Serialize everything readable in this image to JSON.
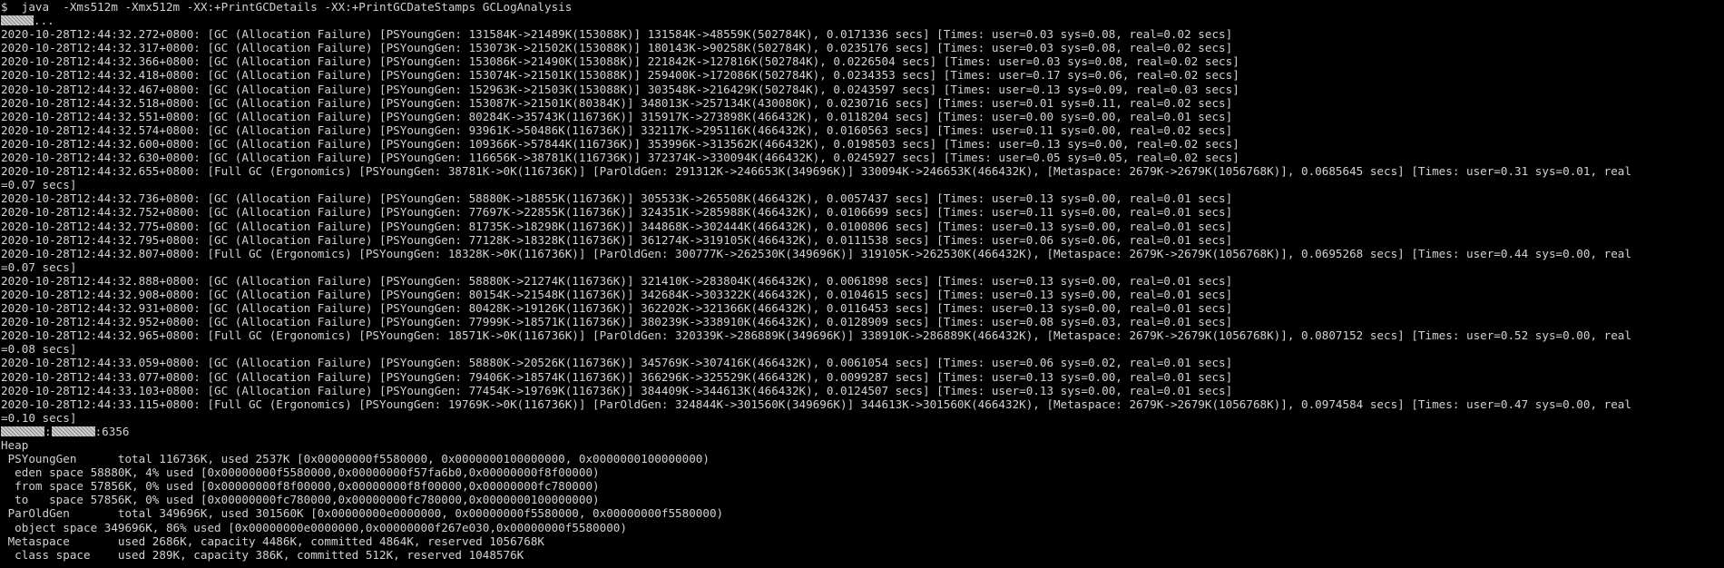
{
  "terminal": {
    "command": "$  java  -Xms512m -Xmx512m -XX:+PrintGCDetails -XX:+PrintGCDateStamps GCLogAnalysis",
    "ellipsis": "...",
    "colon": ":",
    "pid_suffix": ":6356",
    "gc_lines": [
      "2020-10-28T12:44:32.272+0800: [GC (Allocation Failure) [PSYoungGen: 131584K->21489K(153088K)] 131584K->48559K(502784K), 0.0171336 secs] [Times: user=0.03 sys=0.08, real=0.02 secs]",
      "2020-10-28T12:44:32.317+0800: [GC (Allocation Failure) [PSYoungGen: 153073K->21502K(153088K)] 180143K->90258K(502784K), 0.0235176 secs] [Times: user=0.03 sys=0.08, real=0.02 secs]",
      "2020-10-28T12:44:32.366+0800: [GC (Allocation Failure) [PSYoungGen: 153086K->21490K(153088K)] 221842K->127816K(502784K), 0.0226504 secs] [Times: user=0.03 sys=0.08, real=0.02 secs]",
      "2020-10-28T12:44:32.418+0800: [GC (Allocation Failure) [PSYoungGen: 153074K->21501K(153088K)] 259400K->172086K(502784K), 0.0234353 secs] [Times: user=0.17 sys=0.06, real=0.02 secs]",
      "2020-10-28T12:44:32.467+0800: [GC (Allocation Failure) [PSYoungGen: 152963K->21503K(153088K)] 303548K->216429K(502784K), 0.0243597 secs] [Times: user=0.13 sys=0.09, real=0.03 secs]",
      "2020-10-28T12:44:32.518+0800: [GC (Allocation Failure) [PSYoungGen: 153087K->21501K(80384K)] 348013K->257134K(430080K), 0.0230716 secs] [Times: user=0.01 sys=0.11, real=0.02 secs]",
      "2020-10-28T12:44:32.551+0800: [GC (Allocation Failure) [PSYoungGen: 80284K->35743K(116736K)] 315917K->273898K(466432K), 0.0118204 secs] [Times: user=0.00 sys=0.00, real=0.01 secs]",
      "2020-10-28T12:44:32.574+0800: [GC (Allocation Failure) [PSYoungGen: 93961K->50486K(116736K)] 332117K->295116K(466432K), 0.0160563 secs] [Times: user=0.11 sys=0.00, real=0.02 secs]",
      "2020-10-28T12:44:32.600+0800: [GC (Allocation Failure) [PSYoungGen: 109366K->57844K(116736K)] 353996K->313562K(466432K), 0.0198503 secs] [Times: user=0.13 sys=0.00, real=0.02 secs]",
      "2020-10-28T12:44:32.630+0800: [GC (Allocation Failure) [PSYoungGen: 116656K->38781K(116736K)] 372374K->330094K(466432K), 0.0245927 secs] [Times: user=0.05 sys=0.05, real=0.02 secs]",
      "2020-10-28T12:44:32.655+0800: [Full GC (Ergonomics) [PSYoungGen: 38781K->0K(116736K)] [ParOldGen: 291312K->246653K(349696K)] 330094K->246653K(466432K), [Metaspace: 2679K->2679K(1056768K)], 0.0685645 secs] [Times: user=0.31 sys=0.01, real",
      "=0.07 secs]",
      "2020-10-28T12:44:32.736+0800: [GC (Allocation Failure) [PSYoungGen: 58880K->18855K(116736K)] 305533K->265508K(466432K), 0.0057437 secs] [Times: user=0.13 sys=0.00, real=0.01 secs]",
      "2020-10-28T12:44:32.752+0800: [GC (Allocation Failure) [PSYoungGen: 77697K->22855K(116736K)] 324351K->285988K(466432K), 0.0106699 secs] [Times: user=0.11 sys=0.00, real=0.01 secs]",
      "2020-10-28T12:44:32.775+0800: [GC (Allocation Failure) [PSYoungGen: 81735K->18298K(116736K)] 344868K->302444K(466432K), 0.0100806 secs] [Times: user=0.13 sys=0.00, real=0.01 secs]",
      "2020-10-28T12:44:32.795+0800: [GC (Allocation Failure) [PSYoungGen: 77128K->18328K(116736K)] 361274K->319105K(466432K), 0.0111538 secs] [Times: user=0.06 sys=0.06, real=0.01 secs]",
      "2020-10-28T12:44:32.807+0800: [Full GC (Ergonomics) [PSYoungGen: 18328K->0K(116736K)] [ParOldGen: 300777K->262530K(349696K)] 319105K->262530K(466432K), [Metaspace: 2679K->2679K(1056768K)], 0.0695268 secs] [Times: user=0.44 sys=0.00, real",
      "=0.07 secs]",
      "2020-10-28T12:44:32.888+0800: [GC (Allocation Failure) [PSYoungGen: 58880K->21274K(116736K)] 321410K->283804K(466432K), 0.0061898 secs] [Times: user=0.13 sys=0.00, real=0.01 secs]",
      "2020-10-28T12:44:32.908+0800: [GC (Allocation Failure) [PSYoungGen: 80154K->21548K(116736K)] 342684K->303322K(466432K), 0.0104615 secs] [Times: user=0.13 sys=0.00, real=0.01 secs]",
      "2020-10-28T12:44:32.931+0800: [GC (Allocation Failure) [PSYoungGen: 80428K->19126K(116736K)] 362202K->321366K(466432K), 0.0116453 secs] [Times: user=0.13 sys=0.00, real=0.01 secs]",
      "2020-10-28T12:44:32.952+0800: [GC (Allocation Failure) [PSYoungGen: 77999K->18571K(116736K)] 380239K->338910K(466432K), 0.0128909 secs] [Times: user=0.08 sys=0.03, real=0.01 secs]",
      "2020-10-28T12:44:32.965+0800: [Full GC (Ergonomics) [PSYoungGen: 18571K->0K(116736K)] [ParOldGen: 320339K->286889K(349696K)] 338910K->286889K(466432K), [Metaspace: 2679K->2679K(1056768K)], 0.0807152 secs] [Times: user=0.52 sys=0.00, real",
      "=0.08 secs]",
      "2020-10-28T12:44:33.059+0800: [GC (Allocation Failure) [PSYoungGen: 58880K->20526K(116736K)] 345769K->307416K(466432K), 0.0061054 secs] [Times: user=0.06 sys=0.02, real=0.01 secs]",
      "2020-10-28T12:44:33.077+0800: [GC (Allocation Failure) [PSYoungGen: 79406K->18574K(116736K)] 366296K->325529K(466432K), 0.0099287 secs] [Times: user=0.13 sys=0.00, real=0.01 secs]",
      "2020-10-28T12:44:33.103+0800: [GC (Allocation Failure) [PSYoungGen: 77454K->19769K(116736K)] 384409K->344613K(466432K), 0.0124507 secs] [Times: user=0.13 sys=0.00, real=0.01 secs]",
      "2020-10-28T12:44:33.115+0800: [Full GC (Ergonomics) [PSYoungGen: 19769K->0K(116736K)] [ParOldGen: 324844K->301560K(349696K)] 344613K->301560K(466432K), [Metaspace: 2679K->2679K(1056768K)], 0.0974584 secs] [Times: user=0.47 sys=0.00, real",
      "=0.10 secs]"
    ],
    "heap_lines": [
      "Heap",
      " PSYoungGen      total 116736K, used 2537K [0x00000000f5580000, 0x0000000100000000, 0x0000000100000000)",
      "  eden space 58880K, 4% used [0x00000000f5580000,0x00000000f57fa6b0,0x00000000f8f00000)",
      "  from space 57856K, 0% used [0x00000000f8f00000,0x00000000f8f00000,0x00000000fc780000)",
      "  to   space 57856K, 0% used [0x00000000fc780000,0x00000000fc780000,0x0000000100000000)",
      " ParOldGen       total 349696K, used 301560K [0x00000000e0000000, 0x00000000f5580000, 0x00000000f5580000)",
      "  object space 349696K, 86% used [0x00000000e0000000,0x00000000f267e030,0x00000000f5580000)",
      " Metaspace       used 2686K, capacity 4486K, committed 4864K, reserved 1056768K",
      "  class space    used 289K, capacity 386K, committed 512K, reserved 1048576K"
    ]
  }
}
